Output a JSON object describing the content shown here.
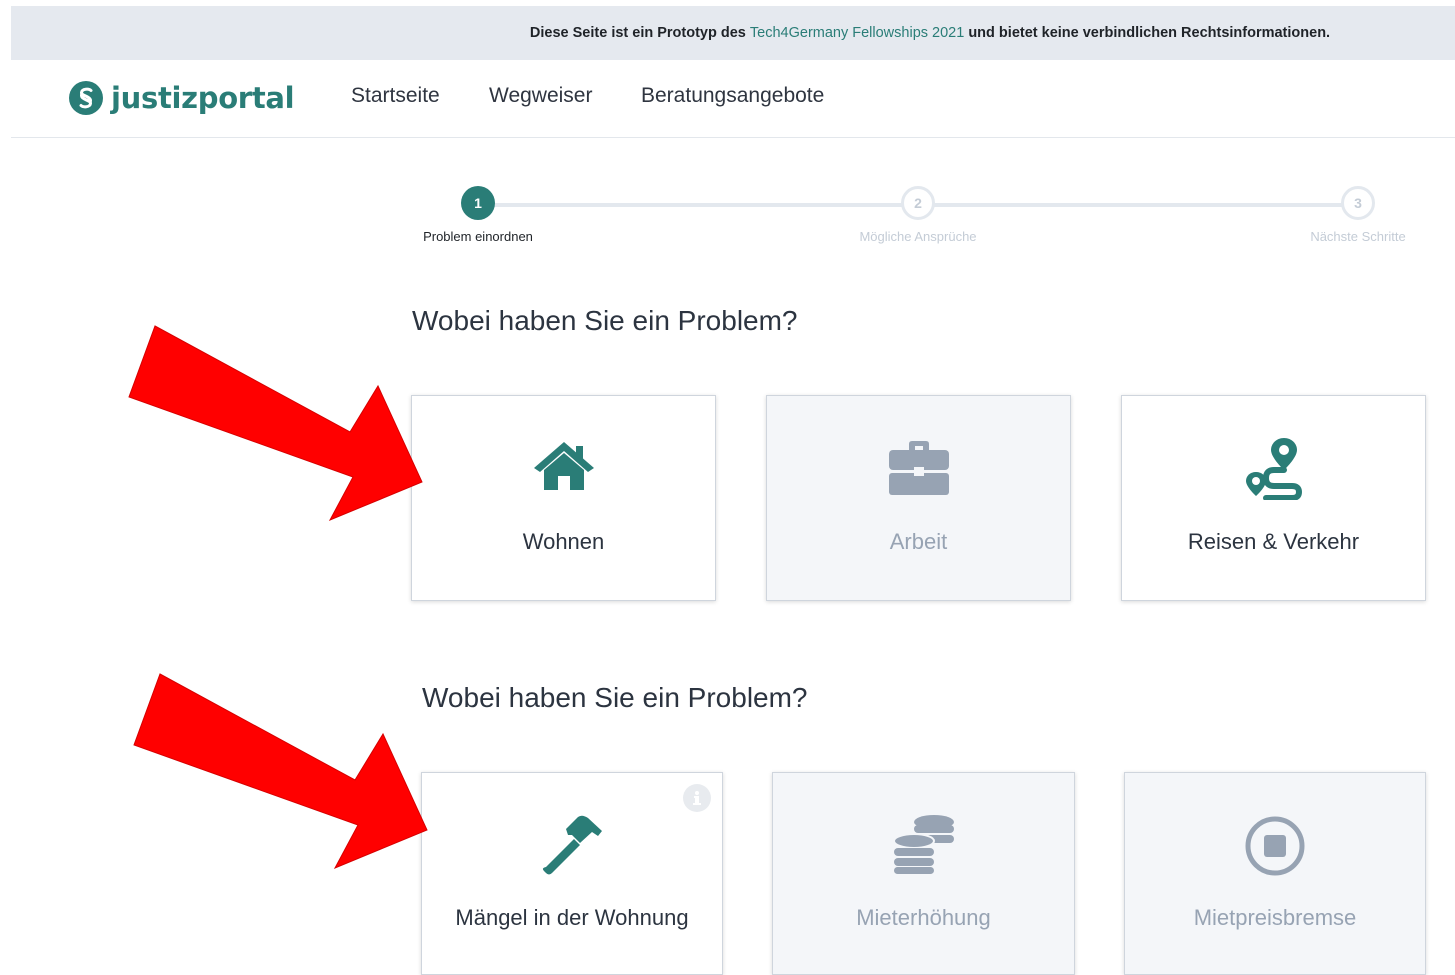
{
  "banner": {
    "text_before": "Diese Seite ist ein Prototyp des",
    "link_text": "Tech4Germany Fellowships 2021",
    "text_after": "und bietet keine verbindlichen Rechtsinformationen."
  },
  "header": {
    "logo_text": "justizportal",
    "nav": [
      "Startseite",
      "Wegweiser",
      "Beratungsangebote"
    ]
  },
  "stepper": {
    "steps": [
      {
        "number": "1",
        "label": "Problem einordnen"
      },
      {
        "number": "2",
        "label": "Mögliche Ansprüche"
      },
      {
        "number": "3",
        "label": "Nächste Schritte"
      }
    ],
    "current_step": 1
  },
  "section1": {
    "heading": "Wobei haben Sie ein Problem?",
    "cards": [
      {
        "label": "Wohnen",
        "icon": "house-icon"
      },
      {
        "label": "Arbeit",
        "icon": "briefcase-icon"
      },
      {
        "label": "Reisen & Verkehr",
        "icon": "route-icon"
      }
    ]
  },
  "section2": {
    "heading": "Wobei haben Sie ein Problem?",
    "cards": [
      {
        "label": "Mängel in der Wohnung",
        "icon": "hammer-icon"
      },
      {
        "label": "Mieterhöhung",
        "icon": "coins-icon"
      },
      {
        "label": "Mietpreisbremse",
        "icon": "stop-circle-icon"
      }
    ]
  },
  "colors": {
    "brand_teal": "#2a7d77",
    "muted_gray": "#97a3b3",
    "annotation_arrow": "#ff0000"
  }
}
